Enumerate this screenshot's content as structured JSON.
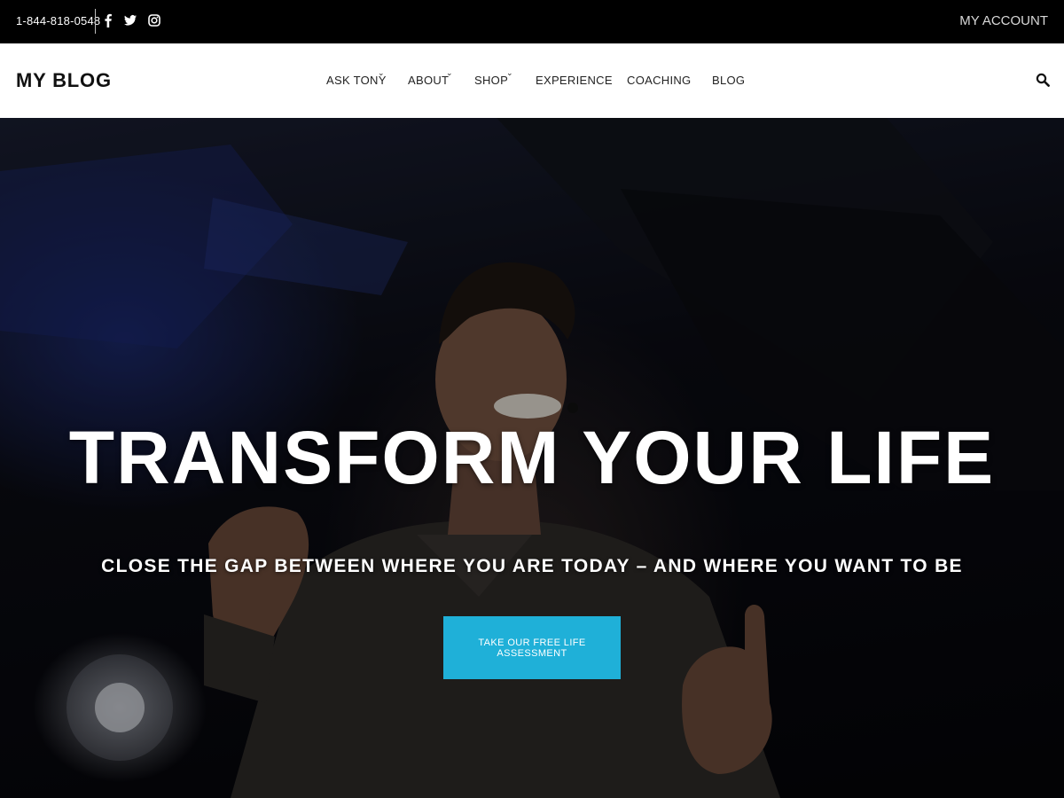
{
  "topbar": {
    "phone": "1-844-818-0548",
    "social": [
      "facebook-icon",
      "twitter-icon",
      "instagram-icon"
    ],
    "account_label": "MY ACCOUNT"
  },
  "nav": {
    "logo": "MY BLOG",
    "items": [
      {
        "label": "ASK TONY",
        "has_dropdown": true
      },
      {
        "label": "ABOUT",
        "has_dropdown": true
      },
      {
        "label": "SHOP",
        "has_dropdown": true
      },
      {
        "label": "EXPERIENCE",
        "has_dropdown": false
      },
      {
        "label": "COACHING",
        "has_dropdown": false
      },
      {
        "label": "BLOG",
        "has_dropdown": false
      }
    ],
    "dropdown_glyph": "⌄",
    "search_icon": "search-icon"
  },
  "hero": {
    "title": "TRANSFORM YOUR LIFE",
    "subtitle": "CLOSE THE GAP BETWEEN WHERE YOU ARE TODAY – AND WHERE YOU WANT TO BE",
    "cta_label": "TAKE OUR FREE LIFE ASSESSMENT"
  },
  "colors": {
    "topbar_bg": "#000000",
    "nav_bg": "#ffffff",
    "cta_bg": "#1fb0d8"
  }
}
